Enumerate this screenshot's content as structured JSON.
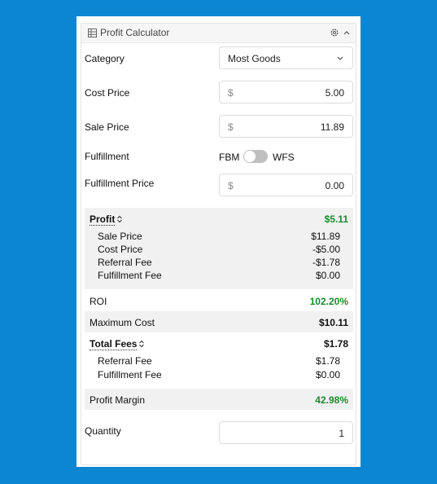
{
  "header": {
    "title": "Profit Calculator"
  },
  "category": {
    "label": "Category",
    "value": "Most Goods"
  },
  "cost_price": {
    "label": "Cost Price",
    "currency": "$",
    "value": "5.00"
  },
  "sale_price": {
    "label": "Sale Price",
    "currency": "$",
    "value": "11.89"
  },
  "fulfillment": {
    "label": "Fulfillment",
    "left": "FBM",
    "right": "WFS",
    "state": "FBM"
  },
  "fulfillment_price": {
    "label": "Fulfillment Price",
    "currency": "$",
    "value": "0.00"
  },
  "profit": {
    "label": "Profit",
    "value": "$5.11",
    "items": [
      {
        "label": "Sale Price",
        "value": "$11.89"
      },
      {
        "label": "Cost Price",
        "value": "-$5.00"
      },
      {
        "label": "Referral Fee",
        "value": "-$1.78"
      },
      {
        "label": "Fulfillment Fee",
        "value": "$0.00"
      }
    ]
  },
  "roi": {
    "label": "ROI",
    "value": "102.20%"
  },
  "max_cost": {
    "label": "Maximum Cost",
    "value": "$10.11"
  },
  "total_fees": {
    "label": "Total Fees",
    "value": "$1.78",
    "items": [
      {
        "label": "Referral Fee",
        "value": "$1.78"
      },
      {
        "label": "Fulfillment Fee",
        "value": "$0.00"
      }
    ]
  },
  "profit_margin": {
    "label": "Profit Margin",
    "value": "42.98%"
  },
  "quantity": {
    "label": "Quantity",
    "value": "1"
  },
  "colors": {
    "background": "#0c86d0",
    "positive": "#1b8a2e"
  }
}
